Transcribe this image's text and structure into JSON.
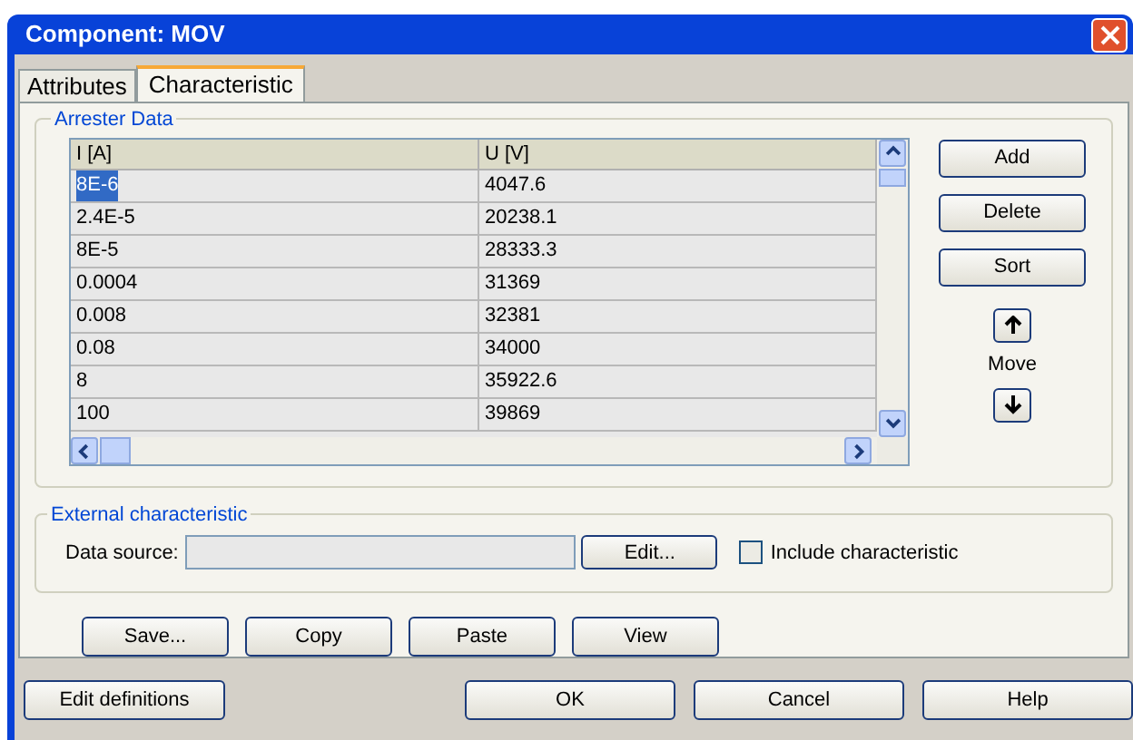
{
  "window": {
    "title": "Component: MOV"
  },
  "tabs": [
    {
      "label": "Attributes",
      "selected": false
    },
    {
      "label": "Characteristic",
      "selected": true
    }
  ],
  "arrester_data": {
    "title": "Arrester Data",
    "columns": [
      "I [A]",
      "U [V]"
    ],
    "rows": [
      {
        "cells": [
          "8E-6",
          "4047.6"
        ],
        "selected": true
      },
      {
        "cells": [
          "2.4E-5",
          "20238.1"
        ],
        "selected": false
      },
      {
        "cells": [
          "8E-5",
          "28333.3"
        ],
        "selected": false
      },
      {
        "cells": [
          "0.0004",
          "31369"
        ],
        "selected": false
      },
      {
        "cells": [
          "0.008",
          "32381"
        ],
        "selected": false
      },
      {
        "cells": [
          "0.08",
          "34000"
        ],
        "selected": false
      },
      {
        "cells": [
          "8",
          "35922.6"
        ],
        "selected": false
      },
      {
        "cells": [
          "100",
          "39869"
        ],
        "selected": false
      }
    ],
    "buttons": [
      "Add",
      "Delete",
      "Sort"
    ],
    "move_label": "Move"
  },
  "external": {
    "title": "External characteristic",
    "source_label": "Data source:",
    "edit_button": "Edit...",
    "include": {
      "label": "Include characteristic",
      "checked": false
    }
  },
  "actions": [
    "Save...",
    "Copy",
    "Paste",
    "View"
  ],
  "footer": {
    "left": "Edit definitions",
    "right": [
      "OK",
      "Cancel",
      "Help"
    ]
  }
}
